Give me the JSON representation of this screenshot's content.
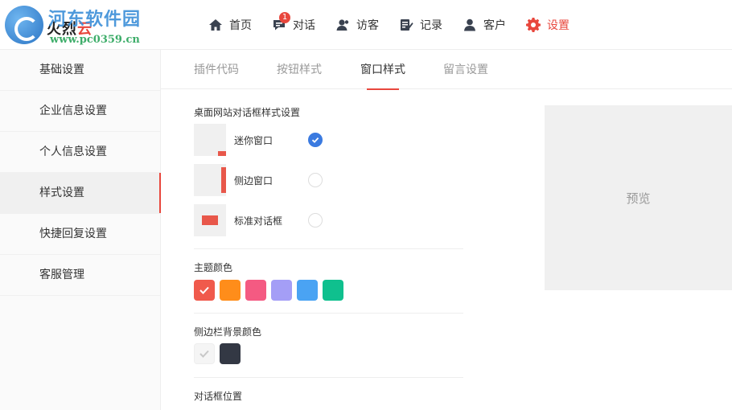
{
  "brand": {
    "name_prefix": "火烈",
    "name_accent": "云",
    "watermark_title": "河东软件园",
    "watermark_url": "www.pc0359.cn"
  },
  "nav": {
    "items": [
      {
        "label": "首页",
        "icon": "home-icon"
      },
      {
        "label": "对话",
        "icon": "chat-icon",
        "badge": "1"
      },
      {
        "label": "访客",
        "icon": "visitor-icon"
      },
      {
        "label": "记录",
        "icon": "record-icon"
      },
      {
        "label": "客户",
        "icon": "customer-icon"
      },
      {
        "label": "设置",
        "icon": "gear-icon",
        "active": true
      }
    ]
  },
  "sidebar": {
    "items": [
      {
        "label": "基础设置"
      },
      {
        "label": "企业信息设置"
      },
      {
        "label": "个人信息设置"
      },
      {
        "label": "样式设置",
        "active": true
      },
      {
        "label": "快捷回复设置"
      },
      {
        "label": "客服管理"
      }
    ]
  },
  "tabs": [
    {
      "label": "插件代码"
    },
    {
      "label": "按钮样式"
    },
    {
      "label": "窗口样式",
      "active": true
    },
    {
      "label": "留言设置"
    }
  ],
  "window_style": {
    "title": "桌面网站对话框样式设置",
    "options": [
      {
        "label": "迷你窗口",
        "checked": true
      },
      {
        "label": "侧边窗口",
        "checked": false
      },
      {
        "label": "标准对话框",
        "checked": false
      }
    ]
  },
  "theme_color": {
    "title": "主题颜色",
    "colors": [
      "#f05a4c",
      "#ff8d1a",
      "#f45a82",
      "#a49ef6",
      "#4aa3f3",
      "#0fc08e"
    ],
    "selected_index": 0
  },
  "sidebar_bg_color": {
    "title": "侧边栏背景颜色",
    "colors": [
      "#f5f5f5",
      "#333844"
    ],
    "selected_index": 0
  },
  "dialog_position": {
    "title": "对话框位置"
  },
  "preview": {
    "label": "预览"
  },
  "colors": {
    "accent": "#e8473d",
    "radio_checked": "#3a7ae0"
  }
}
